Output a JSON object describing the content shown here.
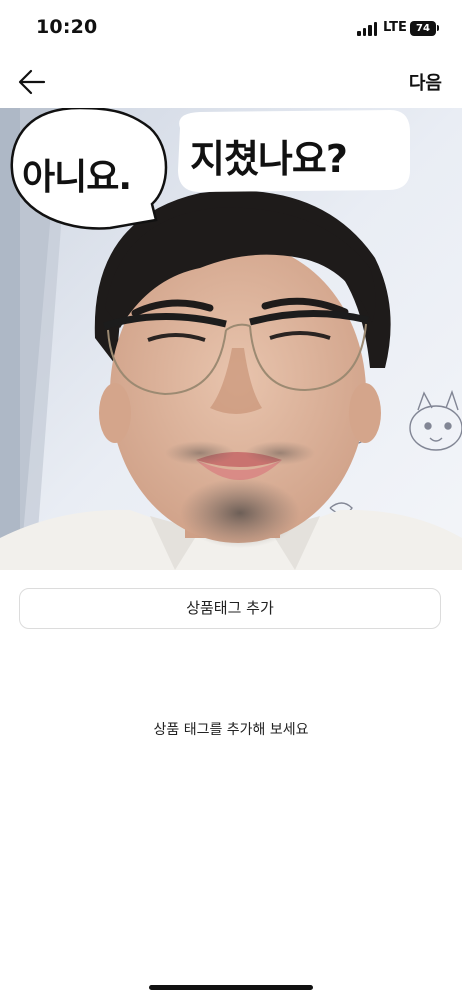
{
  "status_bar": {
    "time": "10:20",
    "network": "LTE",
    "battery": "74"
  },
  "nav": {
    "back_icon": "arrow-left-icon",
    "next_label": "다음"
  },
  "photo": {
    "bubble_left_text": "아니요.",
    "bubble_right_text": "지쳤나요?"
  },
  "tag_button_label": "상품태그 추가",
  "hint": "상품 태그를 추가해 보세요"
}
